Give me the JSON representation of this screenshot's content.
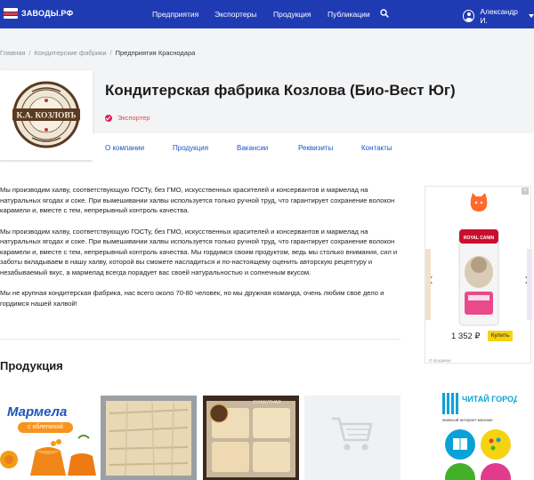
{
  "header": {
    "logo_text": "ЗАВОДЫ.РФ",
    "nav": [
      "Предприятия",
      "Экспортеры",
      "Продукция",
      "Публикации"
    ],
    "user_name": "Александр И."
  },
  "breadcrumbs": [
    "Главная",
    "Кондитерские фабрики",
    "Предприятия Краснодара"
  ],
  "company": {
    "logo_text": "К.А. КОЗЛОВЪ",
    "title": "Кондитерская фабрика Козлова (Био-Вест Юг)",
    "badge": "Экспортер"
  },
  "tabs": [
    "О компании",
    "Продукция",
    "Вакансии",
    "Реквизиты",
    "Контакты"
  ],
  "description": [
    "Мы производим халву, соответствующую ГОСТу, без ГМО, искусственных красителей и консервантов и мармелад на натуральных ягодах и соке. При вымешивании халвы используется только ручной труд, что гарантирует сохранение волокон карамели и, вместе с тем, непрерывный контроль качества.",
    "Мы производим халву, соответствующую ГОСТу, без ГМО, искусственных красителей и консервантов и мармелад на натуральных ягодах и соке. При вымешивании халвы используется только ручной труд, что гарантирует сохранение волокон карамели и, вместе с тем, непрерывный контроль качества. Мы гордимся своим продуктом, ведь мы столько внимания, сил и заботы вкладываем в нашу халву, которой вы сможете насладиться и по-настоящему оценить авторскую рецептуру и незабываемый вкус, а мармелад всегда порадует вас своей натуральностью и солнечным вкусом.",
    "Мы не крупная кондитерская фабрика, нас всего около 70-80 человек, но мы дружная команда, очень любим свое дело и гордимся нашей халвой!"
  ],
  "products_heading": "Продукция",
  "ad": {
    "close": "×",
    "price": "1 352 ₽",
    "button": "Купить",
    "note": "О продавце",
    "brand": "ROYAL CANIN"
  },
  "products": {
    "p1_title": "Мармела",
    "p1_sub": "с облепихой",
    "p3_label": "КУНЖУТНАЯ"
  },
  "side_ad": {
    "brand": "ЧИТАЙ ГОРОД",
    "sub": "книжный интернет-магазин"
  },
  "colors": {
    "topbar": "#1f3bb3",
    "link": "#1f55c4",
    "badge": "#e0205a",
    "ad_button": "#f5d312"
  }
}
